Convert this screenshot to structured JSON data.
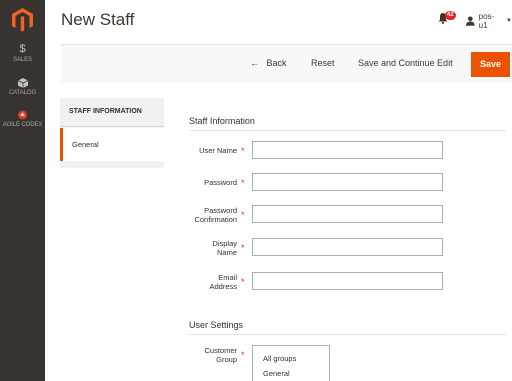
{
  "sidebar": {
    "items": [
      {
        "label": "SALES",
        "icon": "dollar-icon"
      },
      {
        "label": "CATALOG",
        "icon": "box-icon"
      },
      {
        "label": "AGILE CODEX",
        "icon": "codex-icon"
      }
    ]
  },
  "header": {
    "title": "New Staff",
    "notifications_count": "42",
    "user_name": "pos-u1"
  },
  "actions": {
    "back_label": "Back",
    "reset_label": "Reset",
    "save_continue_label": "Save and Continue Edit",
    "save_label": "Save"
  },
  "tabs": {
    "heading": "STAFF INFORMATION",
    "items": [
      {
        "label": "General",
        "active": true
      }
    ]
  },
  "form": {
    "staff_section_title": "Staff Information",
    "fields": {
      "username": {
        "label": "User Name",
        "value": ""
      },
      "password": {
        "label": "Password",
        "value": ""
      },
      "password_confirmation": {
        "label_line1": "Password",
        "label_line2": "Confirmation",
        "value": ""
      },
      "display_name": {
        "label_line1": "Display",
        "label_line2": "Name",
        "value": ""
      },
      "email": {
        "label_line1": "Email",
        "label_line2": "Address",
        "value": ""
      }
    },
    "settings_section_title": "User Settings",
    "customer_group": {
      "label_line1": "Customer",
      "label_line2": "Group",
      "options": [
        "All groups",
        "General"
      ]
    }
  },
  "colors": {
    "accent": "#eb5202",
    "sidebar_bg": "#373330",
    "required": "#e22626"
  }
}
